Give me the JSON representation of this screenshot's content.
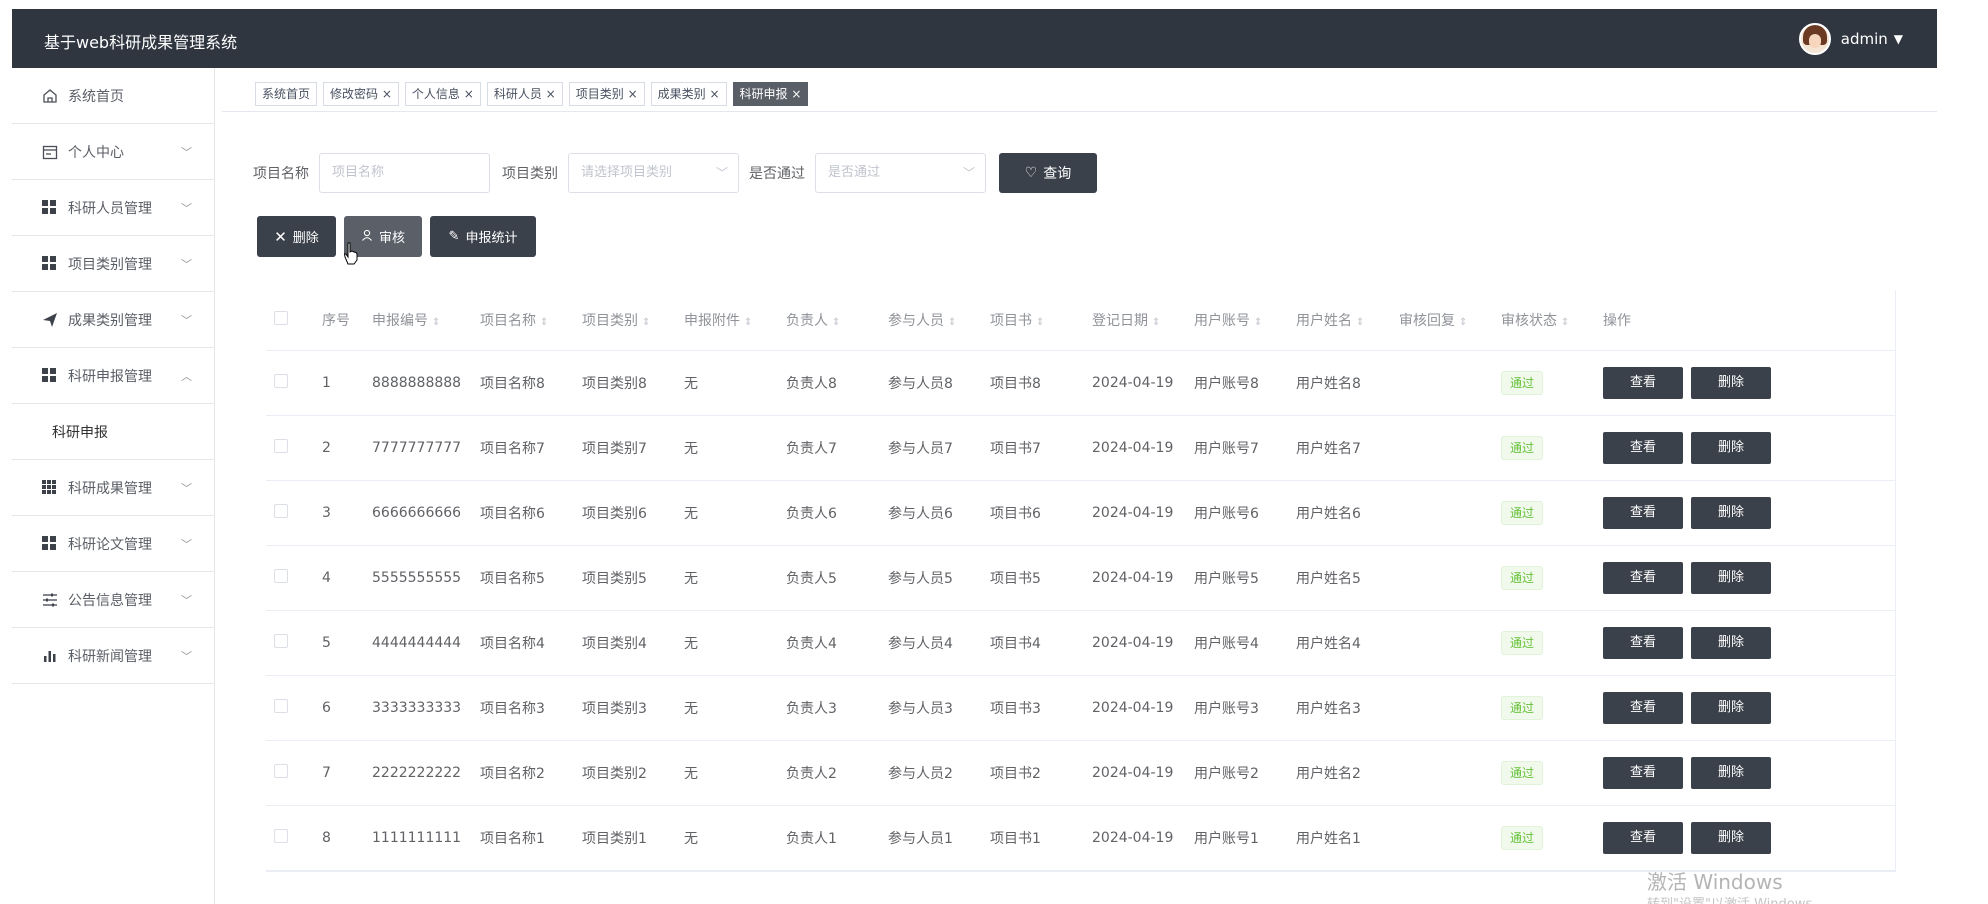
{
  "header": {
    "title": "基于web科研成果管理系统",
    "user": "admin"
  },
  "sidebar": {
    "items": [
      {
        "label": "系统首页",
        "icon": "home-icon"
      },
      {
        "label": "个人中心",
        "icon": "calendar-icon"
      },
      {
        "label": "科研人员管理",
        "icon": "grid-icon"
      },
      {
        "label": "项目类别管理",
        "icon": "grid-icon"
      },
      {
        "label": "成果类别管理",
        "icon": "send-icon"
      },
      {
        "label": "科研申报管理",
        "icon": "grid-icon"
      },
      {
        "label": "科研申报",
        "icon": ""
      },
      {
        "label": "科研成果管理",
        "icon": "apps-icon"
      },
      {
        "label": "科研论文管理",
        "icon": "grid-icon"
      },
      {
        "label": "公告信息管理",
        "icon": "sliders-icon"
      },
      {
        "label": "科研新闻管理",
        "icon": "chart-icon"
      }
    ]
  },
  "tabs": [
    "系统首页",
    "修改密码",
    "个人信息",
    "科研人员",
    "项目类别",
    "成果类别",
    "科研申报"
  ],
  "search": {
    "project_name_label": "项目名称",
    "project_name_placeholder": "项目名称",
    "category_label": "项目类别",
    "category_placeholder": "请选择项目类别",
    "passed_label": "是否通过",
    "passed_placeholder": "是否通过",
    "query_button": "查询"
  },
  "actions": {
    "delete": "删除",
    "review": "审核",
    "stats": "申报统计"
  },
  "table": {
    "headers": [
      "序号",
      "申报编号",
      "项目名称",
      "项目类别",
      "申报附件",
      "负责人",
      "参与人员",
      "项目书",
      "登记日期",
      "用户账号",
      "用户姓名",
      "审核回复",
      "审核状态",
      "操作"
    ],
    "rows": [
      [
        "1",
        "8888888888",
        "项目名称8",
        "项目类别8",
        "无",
        "负责人8",
        "参与人员8",
        "项目书8",
        "2024-04-19",
        "用户账号8",
        "用户姓名8",
        "",
        "通过"
      ],
      [
        "2",
        "7777777777",
        "项目名称7",
        "项目类别7",
        "无",
        "负责人7",
        "参与人员7",
        "项目书7",
        "2024-04-19",
        "用户账号7",
        "用户姓名7",
        "",
        "通过"
      ],
      [
        "3",
        "6666666666",
        "项目名称6",
        "项目类别6",
        "无",
        "负责人6",
        "参与人员6",
        "项目书6",
        "2024-04-19",
        "用户账号6",
        "用户姓名6",
        "",
        "通过"
      ],
      [
        "4",
        "5555555555",
        "项目名称5",
        "项目类别5",
        "无",
        "负责人5",
        "参与人员5",
        "项目书5",
        "2024-04-19",
        "用户账号5",
        "用户姓名5",
        "",
        "通过"
      ],
      [
        "5",
        "4444444444",
        "项目名称4",
        "项目类别4",
        "无",
        "负责人4",
        "参与人员4",
        "项目书4",
        "2024-04-19",
        "用户账号4",
        "用户姓名4",
        "",
        "通过"
      ],
      [
        "6",
        "3333333333",
        "项目名称3",
        "项目类别3",
        "无",
        "负责人3",
        "参与人员3",
        "项目书3",
        "2024-04-19",
        "用户账号3",
        "用户姓名3",
        "",
        "通过"
      ],
      [
        "7",
        "2222222222",
        "项目名称2",
        "项目类别2",
        "无",
        "负责人2",
        "参与人员2",
        "项目书2",
        "2024-04-19",
        "用户账号2",
        "用户姓名2",
        "",
        "通过"
      ],
      [
        "8",
        "1111111111",
        "项目名称1",
        "项目类别1",
        "无",
        "负责人1",
        "参与人员1",
        "项目书1",
        "2024-04-19",
        "用户账号1",
        "用户姓名1",
        "",
        "通过"
      ]
    ],
    "view_button": "查看",
    "delete_button": "删除"
  },
  "watermark": {
    "line1": "激活 Windows",
    "line2": "转到\"设置\"以激活 Windows。"
  }
}
